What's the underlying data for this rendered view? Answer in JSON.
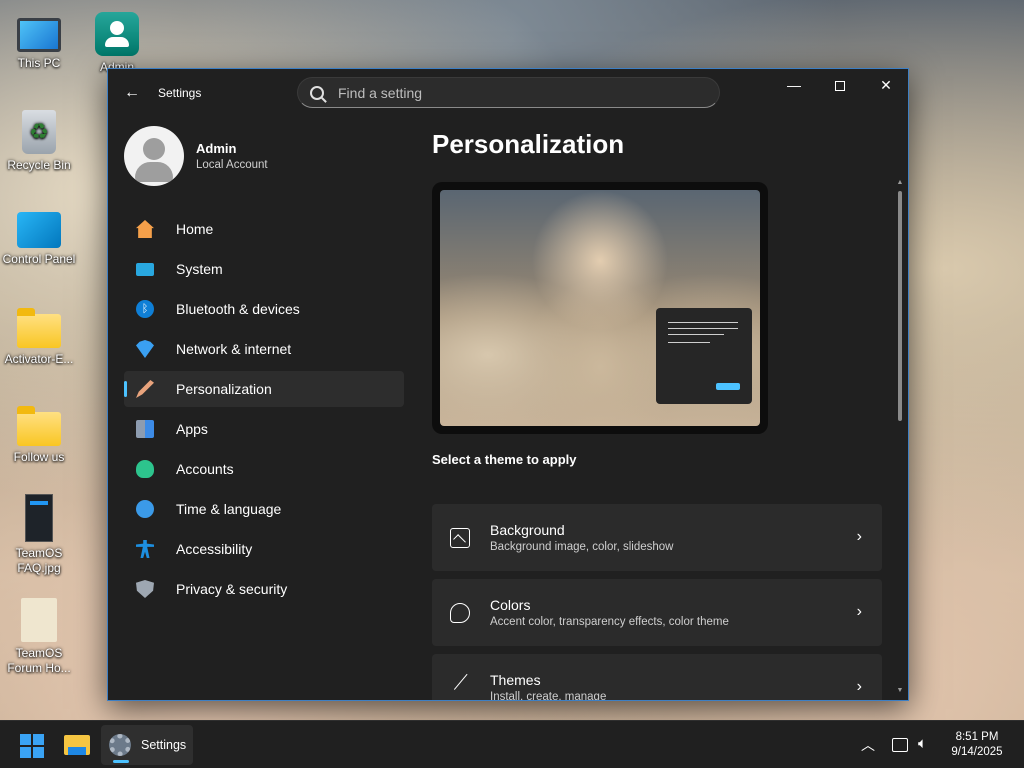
{
  "desktop": {
    "icons": [
      {
        "label": "This PC",
        "icon": "monitor-icon"
      },
      {
        "label": "Admin",
        "icon": "user-folder-icon"
      },
      {
        "label": "Recycle Bin",
        "icon": "recycle-bin-icon"
      },
      {
        "label": "Control Panel",
        "icon": "control-panel-icon"
      },
      {
        "label": "Activator-E...",
        "icon": "folder-icon"
      },
      {
        "label": "Follow us",
        "icon": "folder-icon"
      },
      {
        "label": "TeamOS FAQ.jpg",
        "icon": "image-file-icon"
      },
      {
        "label": "TeamOS Forum Ho...",
        "icon": "document-icon"
      }
    ]
  },
  "window": {
    "app_title": "Settings",
    "search_placeholder": "Find a setting",
    "accent": "#4cc2ff",
    "border": "#3d7fc4"
  },
  "profile": {
    "name": "Admin",
    "subtitle": "Local Account"
  },
  "nav": {
    "items": [
      {
        "label": "Home",
        "icon": "home-icon"
      },
      {
        "label": "System",
        "icon": "system-monitor-icon"
      },
      {
        "label": "Bluetooth & devices",
        "icon": "bluetooth-icon"
      },
      {
        "label": "Network & internet",
        "icon": "wifi-icon"
      },
      {
        "label": "Personalization",
        "icon": "paintbrush-icon",
        "active": true
      },
      {
        "label": "Apps",
        "icon": "apps-icon"
      },
      {
        "label": "Accounts",
        "icon": "account-icon"
      },
      {
        "label": "Time & language",
        "icon": "globe-clock-icon"
      },
      {
        "label": "Accessibility",
        "icon": "accessibility-icon"
      },
      {
        "label": "Privacy & security",
        "icon": "shield-icon"
      }
    ]
  },
  "content": {
    "title": "Personalization",
    "section_label": "Select a theme to apply",
    "cards": [
      {
        "title": "Background",
        "subtitle": "Background image, color, slideshow",
        "icon": "image-icon"
      },
      {
        "title": "Colors",
        "subtitle": "Accent color, transparency effects, color theme",
        "icon": "palette-icon"
      },
      {
        "title": "Themes",
        "subtitle": "Install, create, manage",
        "icon": "brush-icon"
      }
    ]
  },
  "taskbar": {
    "settings_label": "Settings",
    "time": "8:51 PM",
    "date": "9/14/2025"
  }
}
